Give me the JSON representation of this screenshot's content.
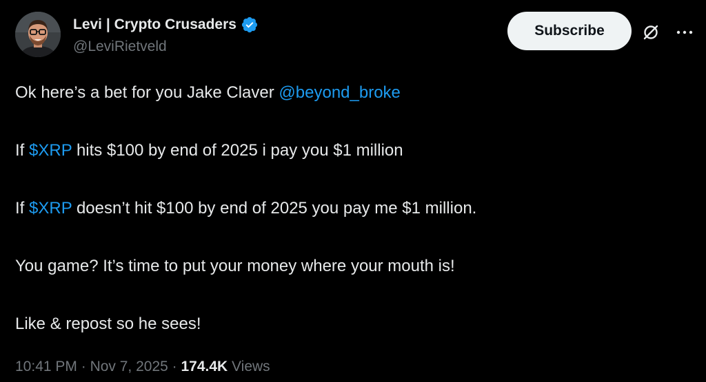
{
  "author": {
    "display_name": "Levi | Crypto Crusaders",
    "handle": "@LeviRietveld",
    "verified": true,
    "verified_icon": "verified-badge-icon"
  },
  "actions": {
    "subscribe_label": "Subscribe",
    "grok_icon": "grok-icon",
    "more_icon": "more-icon"
  },
  "post": {
    "line1_text": "Ok here’s a bet for you Jake Claver ",
    "line1_mention": "@beyond_broke",
    "line2_prefix": "If ",
    "line2_cashtag": "$XRP",
    "line2_suffix": " hits $100 by end of 2025 i pay you $1 million",
    "line3_prefix": "If ",
    "line3_cashtag": "$XRP",
    "line3_suffix": " doesn’t hit $100 by end of 2025 you pay me $1 million.",
    "line4_text": "You game? It’s time to put your money where your mouth is!",
    "line5_text": "Like & repost so he sees!"
  },
  "meta": {
    "time": "10:41 PM",
    "separator1": " · ",
    "date": "Nov 7, 2025",
    "separator2": " · ",
    "views_count": "174.4K",
    "views_label": " Views"
  },
  "colors": {
    "background": "#000000",
    "text": "#e7e9ea",
    "secondary": "#71767b",
    "link": "#1d9bf0",
    "button_bg": "#eff3f4"
  }
}
